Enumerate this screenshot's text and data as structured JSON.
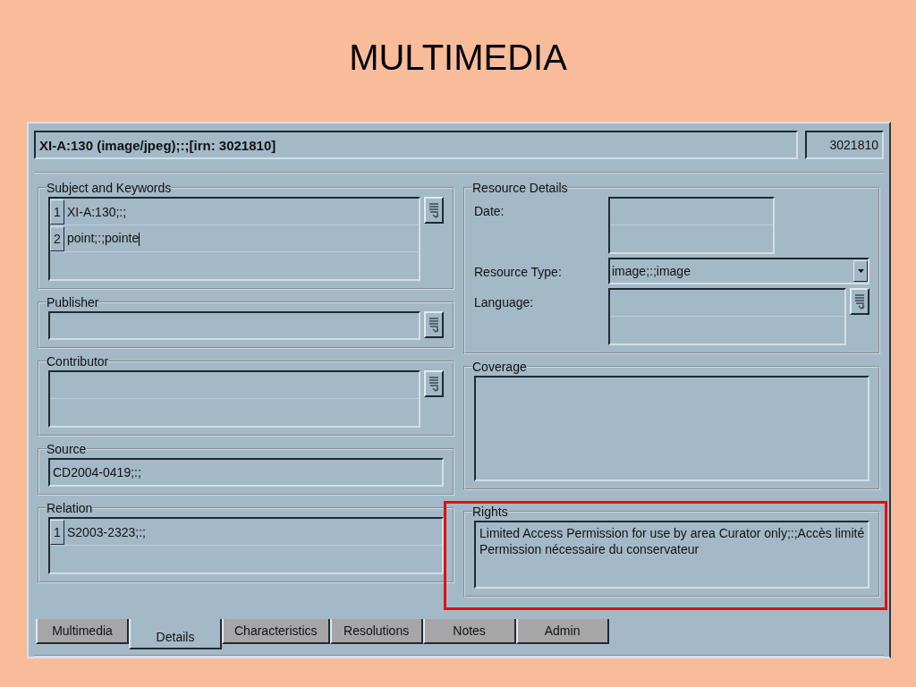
{
  "slide_title": "MULTIMEDIA",
  "window": {
    "record_title": "XI-A:130 (image/jpeg);:;[irn: 3021810]",
    "irn": "3021810"
  },
  "left_groups": [
    {
      "title": "Subject and Keywords",
      "kind": "list",
      "lookup": true,
      "entries": [
        {
          "number": "1",
          "value": "XI-A:130;:;"
        },
        {
          "number": "2",
          "value": "point;:;pointe",
          "cursor": true
        }
      ]
    },
    {
      "title": "Publisher",
      "kind": "single",
      "lookup": true
    },
    {
      "title": "Contributor",
      "kind": "list",
      "lookup": true
    },
    {
      "title": "Source",
      "kind": "single",
      "lookup": false,
      "value": "CD2004-0419;:;"
    },
    {
      "title": "Relation",
      "kind": "list",
      "lookup": false,
      "entries": [
        {
          "number": "1",
          "value": "S2003-2323;:;"
        }
      ]
    }
  ],
  "resource_details": {
    "title": "Resource Details",
    "fields": [
      {
        "label": "Date:",
        "kind": "multi",
        "lookup": false
      },
      {
        "label": "Resource Type:",
        "kind": "dropdown",
        "value": "image;:;image"
      },
      {
        "label": "Language:",
        "kind": "multi",
        "lookup": true
      }
    ]
  },
  "right_groups": [
    {
      "title": "Coverage",
      "kind": "area",
      "highlighted": false
    },
    {
      "title": "Rights",
      "kind": "area",
      "highlighted": true,
      "lines": [
        "Limited Access Permission for use by area Curator only;:;Accès limité",
        "Permission nécessaire du conservateur"
      ]
    }
  ],
  "tabs": [
    {
      "label": "Multimedia",
      "selected": false
    },
    {
      "label": "Details",
      "selected": true
    },
    {
      "label": "Characteristics",
      "selected": false
    },
    {
      "label": "Resolutions",
      "selected": false
    },
    {
      "label": "Notes",
      "selected": false
    },
    {
      "label": "Admin",
      "selected": false
    }
  ]
}
